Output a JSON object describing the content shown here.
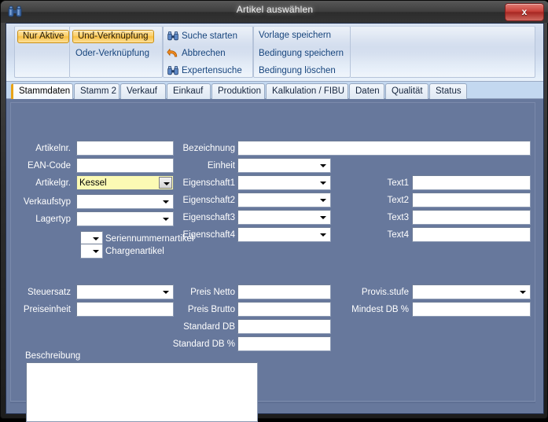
{
  "window": {
    "title": "Artikel auswählen",
    "icon": "binoculars-icon",
    "close_label": "x"
  },
  "toolbar": {
    "groups": [
      {
        "name": "filter",
        "items": [
          {
            "label": "Nur Aktive",
            "state": "on",
            "kind": "toggle"
          }
        ]
      },
      {
        "name": "linking",
        "items": [
          {
            "label": "Und-Verknüpfung",
            "state": "on",
            "kind": "toggle"
          },
          {
            "label": "Oder-Verknüpfung",
            "state": "off",
            "kind": "toggle"
          }
        ]
      },
      {
        "name": "actions",
        "items": [
          {
            "label": "Suche starten",
            "icon": "binoculars-icon"
          },
          {
            "label": "Abbrechen",
            "icon": "undo-arrow-icon"
          },
          {
            "label": "Expertensuche",
            "icon": "binoculars-icon"
          }
        ]
      },
      {
        "name": "templates",
        "items": [
          {
            "label": "Vorlage speichern"
          },
          {
            "label": "Bedingung speichern"
          },
          {
            "label": "Bedingung löschen"
          }
        ]
      }
    ]
  },
  "tabs": [
    {
      "label": "Stammdaten",
      "active": true
    },
    {
      "label": "Stamm 2",
      "active": false
    },
    {
      "label": "Verkauf",
      "active": false
    },
    {
      "label": "Einkauf",
      "active": false
    },
    {
      "label": "Produktion",
      "active": false
    },
    {
      "label": "Kalkulation / FIBU",
      "active": false
    },
    {
      "label": "Daten",
      "active": false
    },
    {
      "label": "Qualität",
      "active": false
    },
    {
      "label": "Status",
      "active": false
    }
  ],
  "form": {
    "col1": [
      {
        "label": "Artikelnr.",
        "type": "text",
        "value": ""
      },
      {
        "label": "EAN-Code",
        "type": "text",
        "value": ""
      },
      {
        "label": "Artikelgr.",
        "type": "combo",
        "value": "Kessel",
        "highlight": true
      },
      {
        "label": "Verkaufstyp",
        "type": "combo",
        "value": ""
      },
      {
        "label": "Lagertyp",
        "type": "combo",
        "value": ""
      }
    ],
    "checkboxes": [
      {
        "label": "Seriennummernartikel",
        "type": "combo",
        "value": ""
      },
      {
        "label": "Chargenartikel",
        "type": "combo",
        "value": ""
      }
    ],
    "col2": [
      {
        "label": "Bezeichnung",
        "type": "text",
        "value": ""
      },
      {
        "label": "Einheit",
        "type": "combo",
        "value": ""
      },
      {
        "label": "Eigenschaft1",
        "type": "combo",
        "value": ""
      },
      {
        "label": "Eigenschaft2",
        "type": "combo",
        "value": ""
      },
      {
        "label": "Eigenschaft3",
        "type": "combo",
        "value": ""
      },
      {
        "label": "Eigenschaft4",
        "type": "combo",
        "value": ""
      }
    ],
    "col3": [
      {
        "label": "Text1",
        "type": "text",
        "value": ""
      },
      {
        "label": "Text2",
        "type": "text",
        "value": ""
      },
      {
        "label": "Text3",
        "type": "text",
        "value": ""
      },
      {
        "label": "Text4",
        "type": "text",
        "value": ""
      }
    ],
    "prices_left": [
      {
        "label": "Steuersatz",
        "type": "combo",
        "value": ""
      },
      {
        "label": "Preiseinheit",
        "type": "text",
        "value": ""
      }
    ],
    "prices_mid": [
      {
        "label": "Preis Netto",
        "type": "text",
        "value": ""
      },
      {
        "label": "Preis Brutto",
        "type": "text",
        "value": ""
      },
      {
        "label": "Standard DB",
        "type": "text",
        "value": ""
      },
      {
        "label": "Standard DB %",
        "type": "text",
        "value": ""
      }
    ],
    "prices_right": [
      {
        "label": "Provis.stufe",
        "type": "combo",
        "value": ""
      },
      {
        "label": "Mindest DB %",
        "type": "text",
        "value": ""
      }
    ],
    "description": {
      "label": "Beschreibung",
      "value": ""
    }
  },
  "colors": {
    "form_background": "#67789c",
    "ribbon_background": "#cdd9ec",
    "tabstrip_background": "#c3d8f0",
    "active_toggle": "#f8c044",
    "link_text": "#17457d",
    "highlight_field": "#fbfab4",
    "close_button": "#c8413a"
  }
}
